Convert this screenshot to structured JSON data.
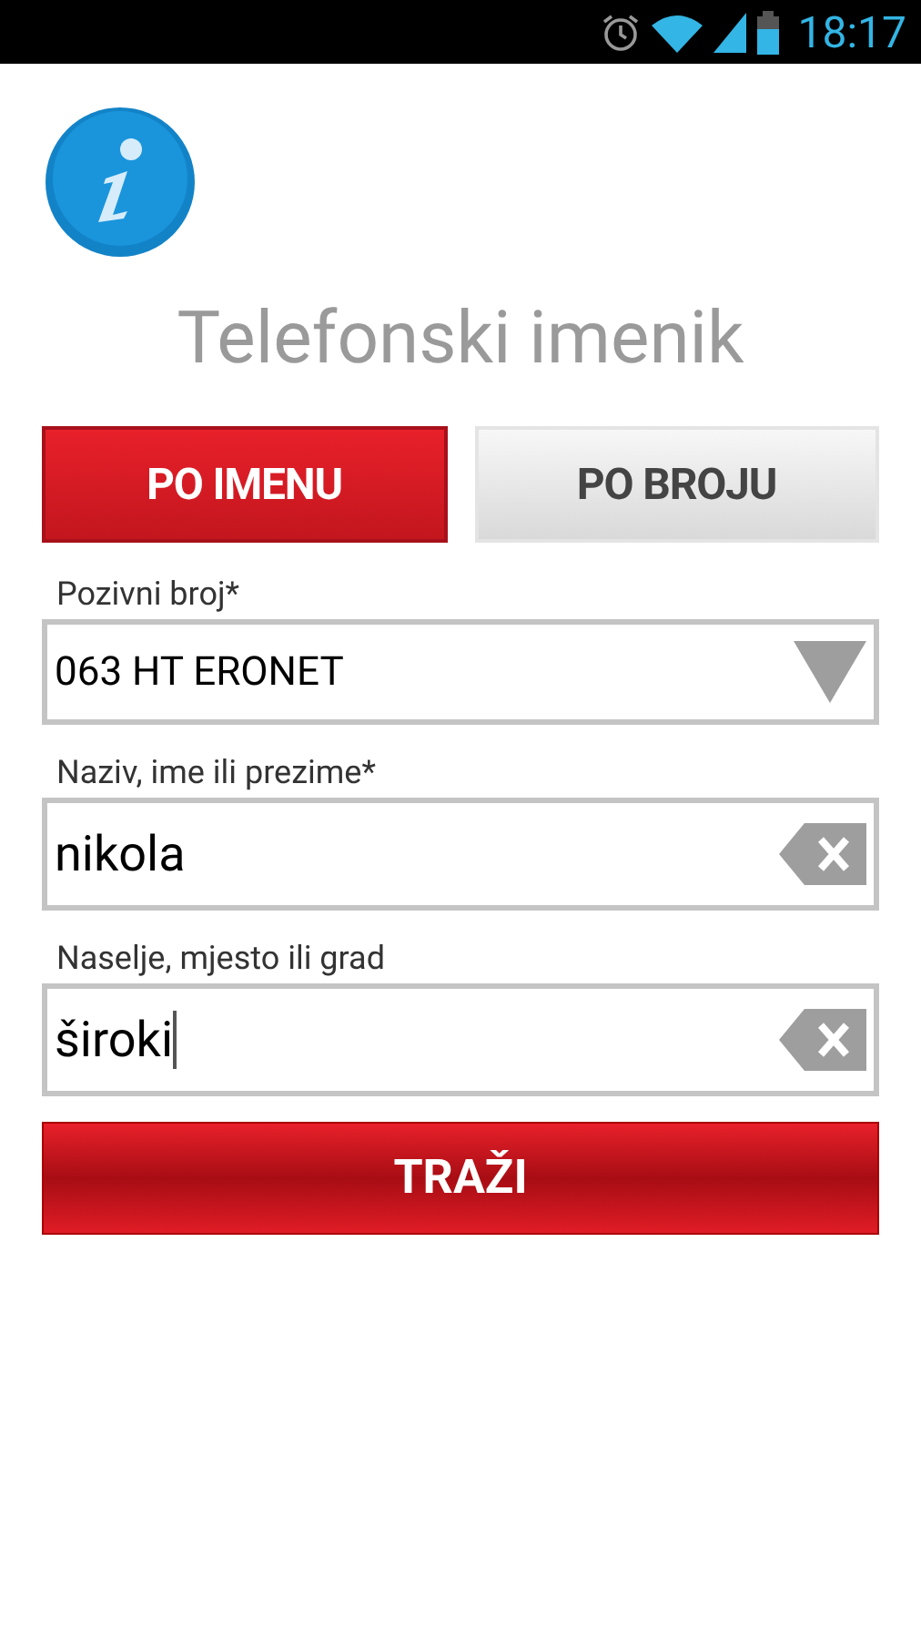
{
  "status_bar": {
    "time": "18:17"
  },
  "title": "Telefonski imenik",
  "tabs": [
    {
      "label": "PO IMENU",
      "selected": true
    },
    {
      "label": "PO BROJU",
      "selected": false
    }
  ],
  "fields": [
    {
      "kind": "select",
      "label": "Pozivni broj*",
      "value": "063 HT ERONET",
      "focused": false
    },
    {
      "kind": "text",
      "label": "Naziv, ime ili prezime*",
      "value": "nikola",
      "focused": false
    },
    {
      "kind": "text",
      "label": "Naselje, mjesto ili grad",
      "value": "široki",
      "focused": true
    }
  ],
  "search_button": "TRAŽI"
}
